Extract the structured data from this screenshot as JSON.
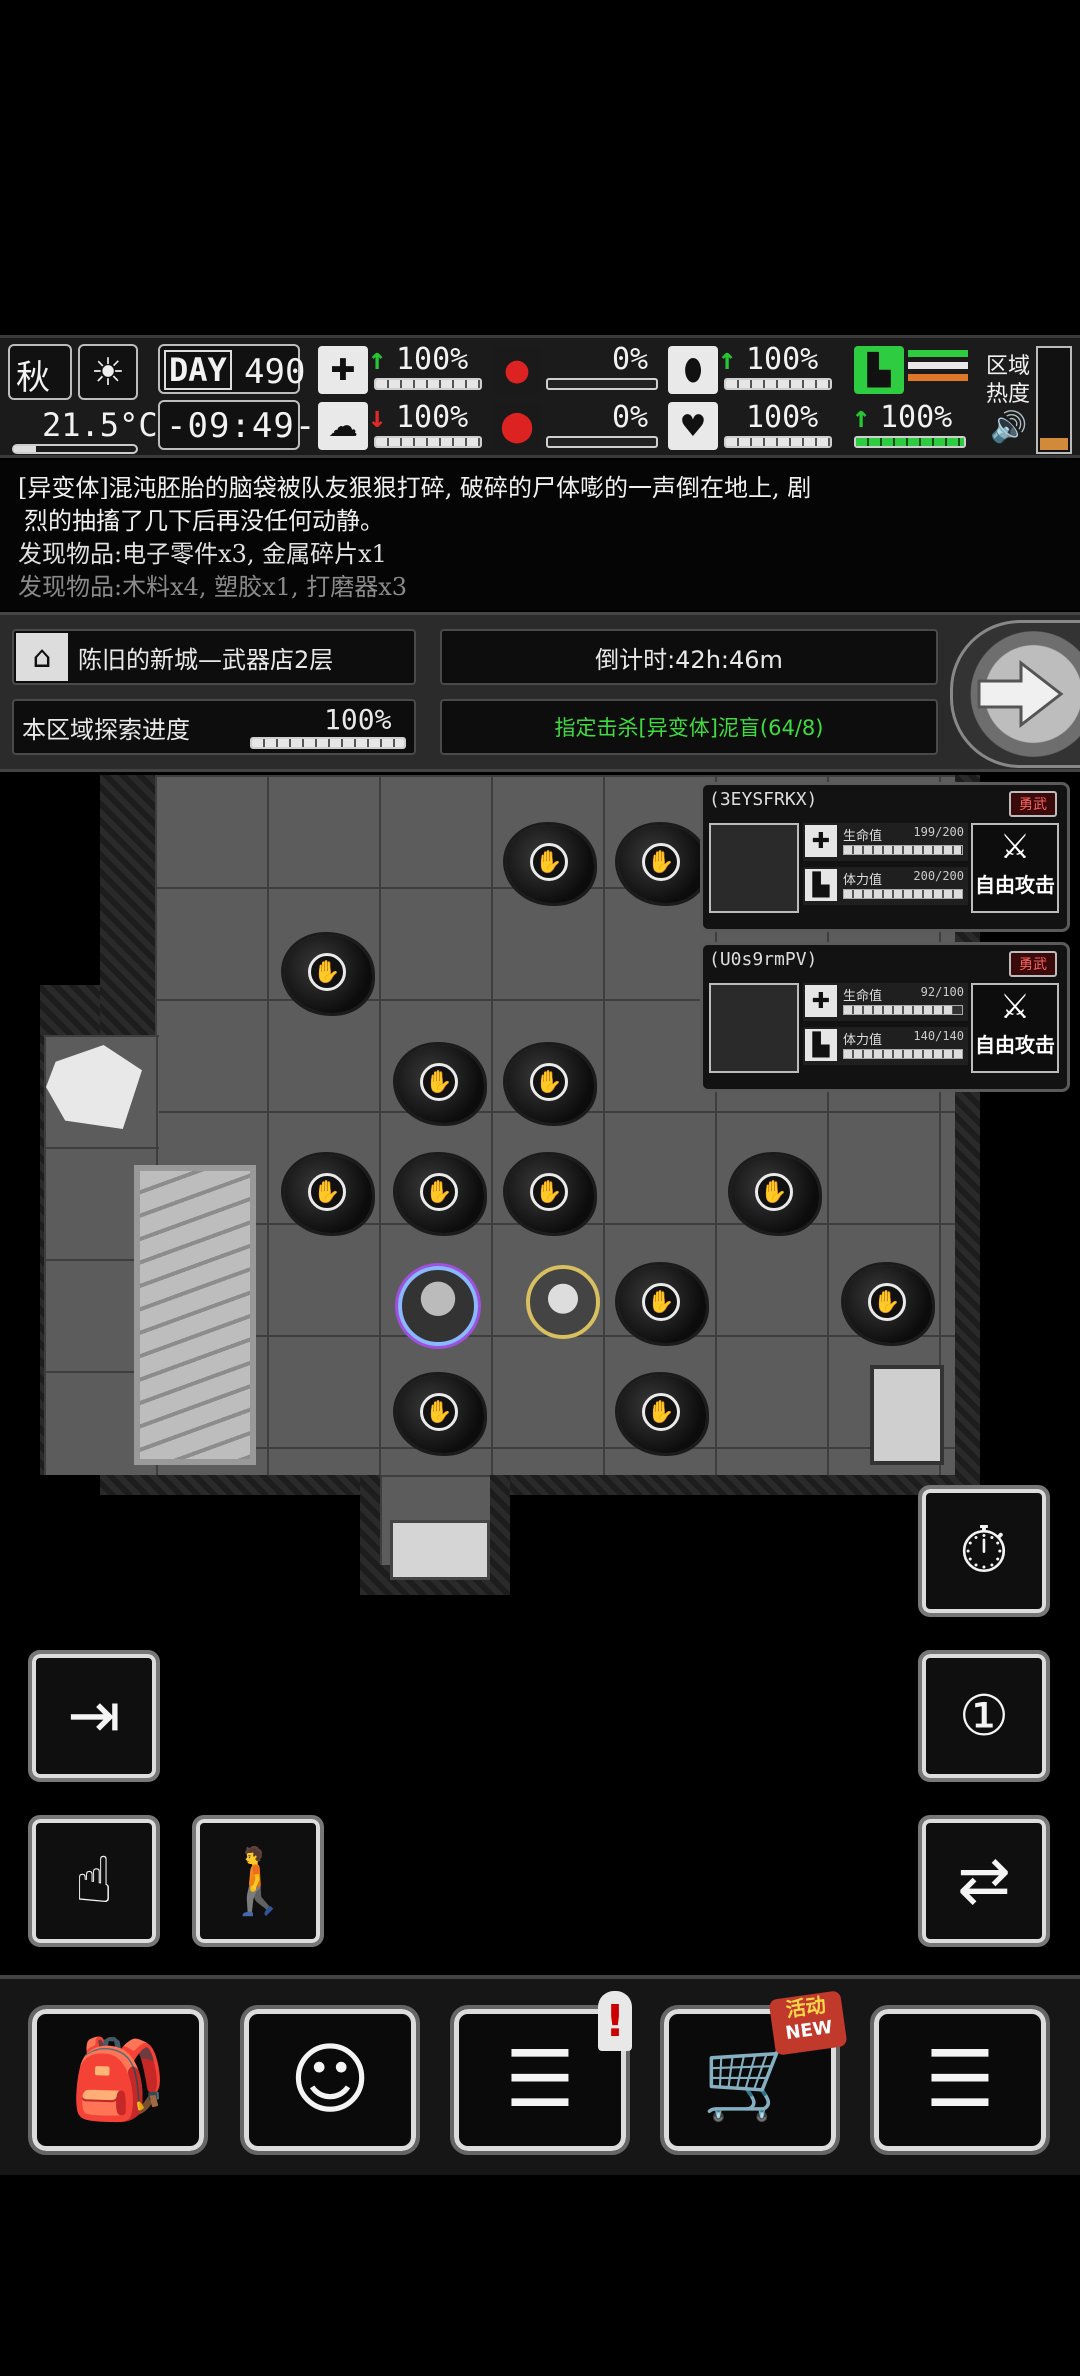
{
  "hud": {
    "season": "秋",
    "weather_icon": "sun-icon",
    "temperature": "21.5°C",
    "day_label": "DAY",
    "day": "490",
    "time": "-09:49-",
    "health": "100%",
    "stomach": "0%",
    "pill": "100%",
    "sanity": "100%",
    "water": "0%",
    "heart": "100%",
    "stamina": "100%",
    "area_heat_label_1": "区域",
    "area_heat_label_2": "热度"
  },
  "log": {
    "line1": "[异变体]混沌胚胎的脑袋被队友狠狠打碎, 破碎的尸体嘭的一声倒在地上, 剧",
    "line2": "烈的抽搐了几下后再没任何动静。",
    "line3": "发现物品:电子零件x3, 金属碎片x1",
    "line4": "发现物品:木料x4, 塑胶x1, 打磨器x3"
  },
  "location": {
    "name": "陈旧的新城—武器店2层",
    "countdown": "倒计时:42h:46m",
    "explore_label": "本区域探索进度",
    "explore_value": "100%",
    "objective": "指定击杀[异变体]泥盲(64/8)",
    "objective_color": "#3fdc3f"
  },
  "team": [
    {
      "name": "(3EYSFRKX)",
      "badge": "勇武",
      "hp_label": "生命值",
      "hp": "199/200",
      "hp_fraction": 0.995,
      "sta_label": "体力值",
      "sta": "200/200",
      "sta_fraction": 1.0,
      "attack_label": "自由攻击"
    },
    {
      "name": "(U0s9rmPV)",
      "badge": "勇武",
      "hp_label": "生命值",
      "hp": "92/100",
      "hp_fraction": 0.92,
      "sta_label": "体力值",
      "sta": "140/140",
      "sta_fraction": 1.0,
      "attack_label": "自由攻击"
    }
  ],
  "nav": {
    "backpack": "backpack-icon",
    "skills": "brain-icon",
    "notes": "notebook-icon",
    "shop": "cart-icon",
    "shop_badge_1": "活动",
    "shop_badge_2": "NEW",
    "menu": "menu-icon"
  }
}
